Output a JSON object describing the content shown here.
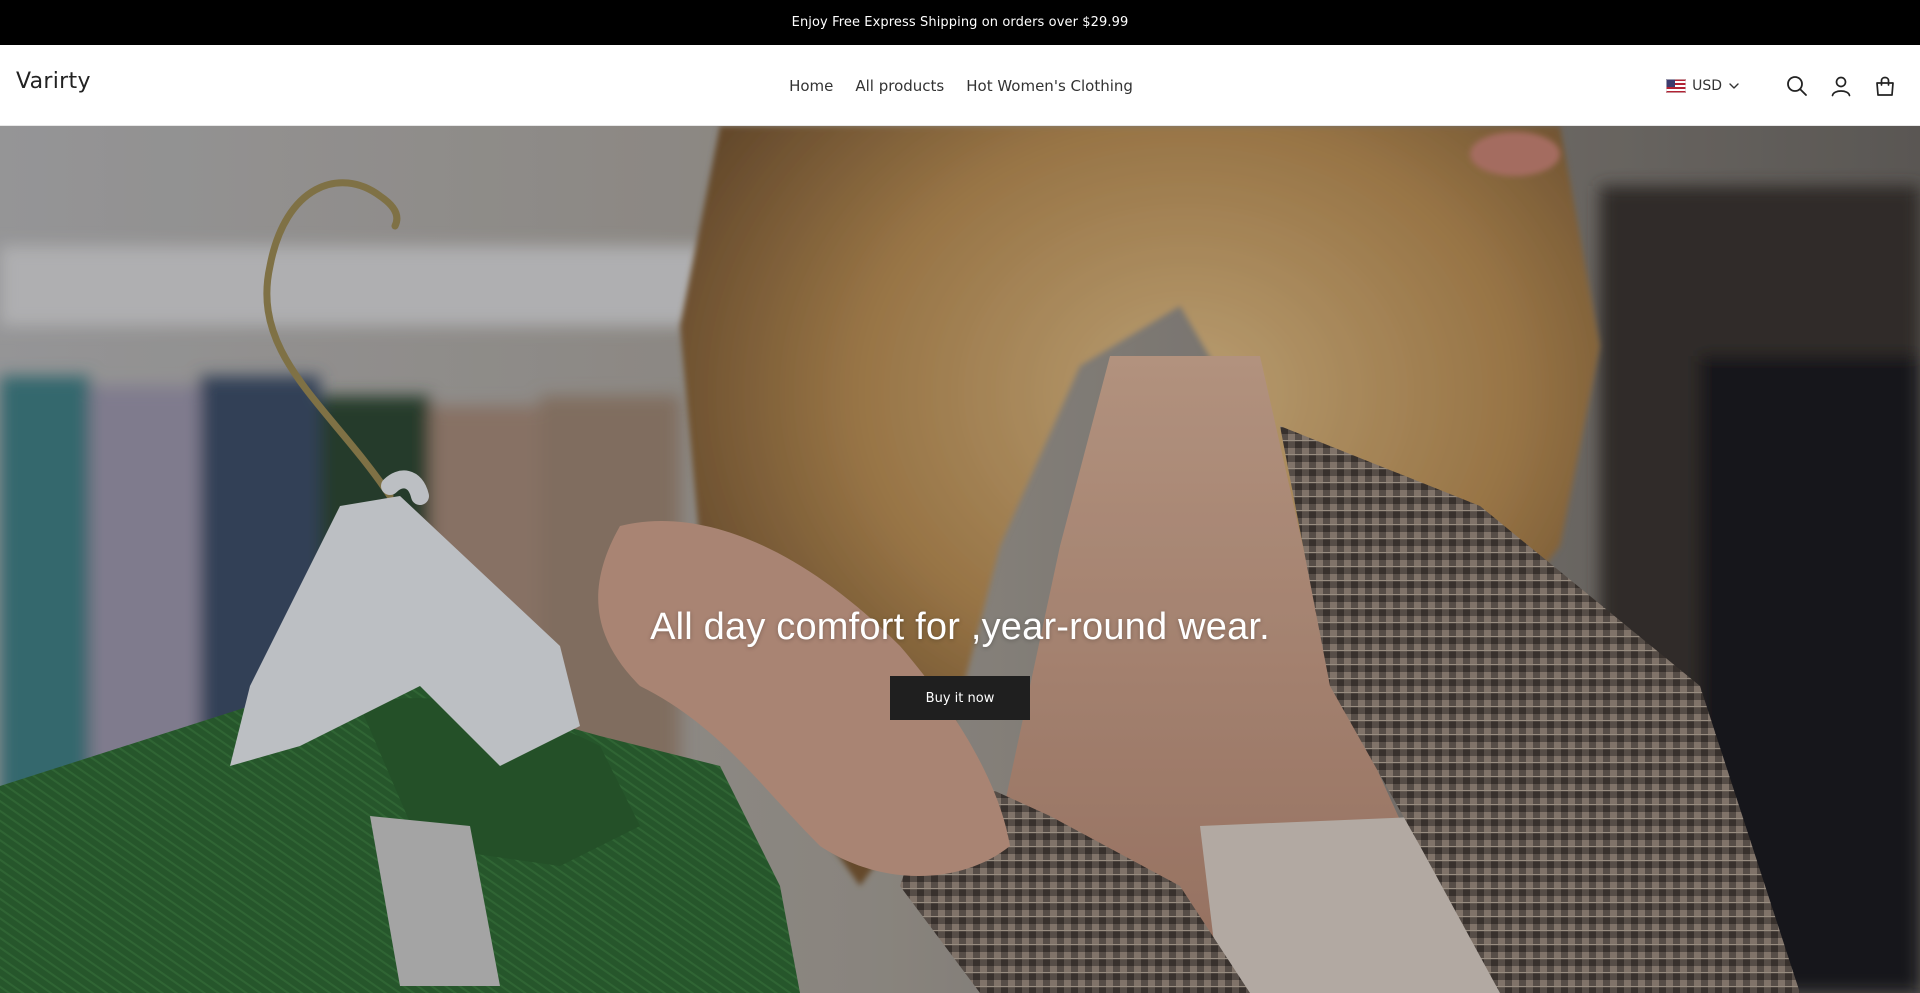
{
  "announcement": {
    "text": "Enjoy Free Express Shipping on orders over $29.99"
  },
  "header": {
    "logo": "Varirty",
    "nav": [
      {
        "label": "Home"
      },
      {
        "label": "All products"
      },
      {
        "label": "Hot Women's Clothing"
      }
    ],
    "currency": {
      "code": "USD",
      "flag_icon": "us-flag-icon"
    },
    "icons": [
      "search-icon",
      "account-icon",
      "cart-icon"
    ]
  },
  "hero": {
    "title": "All day comfort for ,year-round wear.",
    "button_label": "Buy it now"
  },
  "colors": {
    "announcement_bg": "#000000",
    "announcement_text": "#ffffff",
    "button_bg": "#1f1f1f",
    "button_text": "#ffffff"
  }
}
